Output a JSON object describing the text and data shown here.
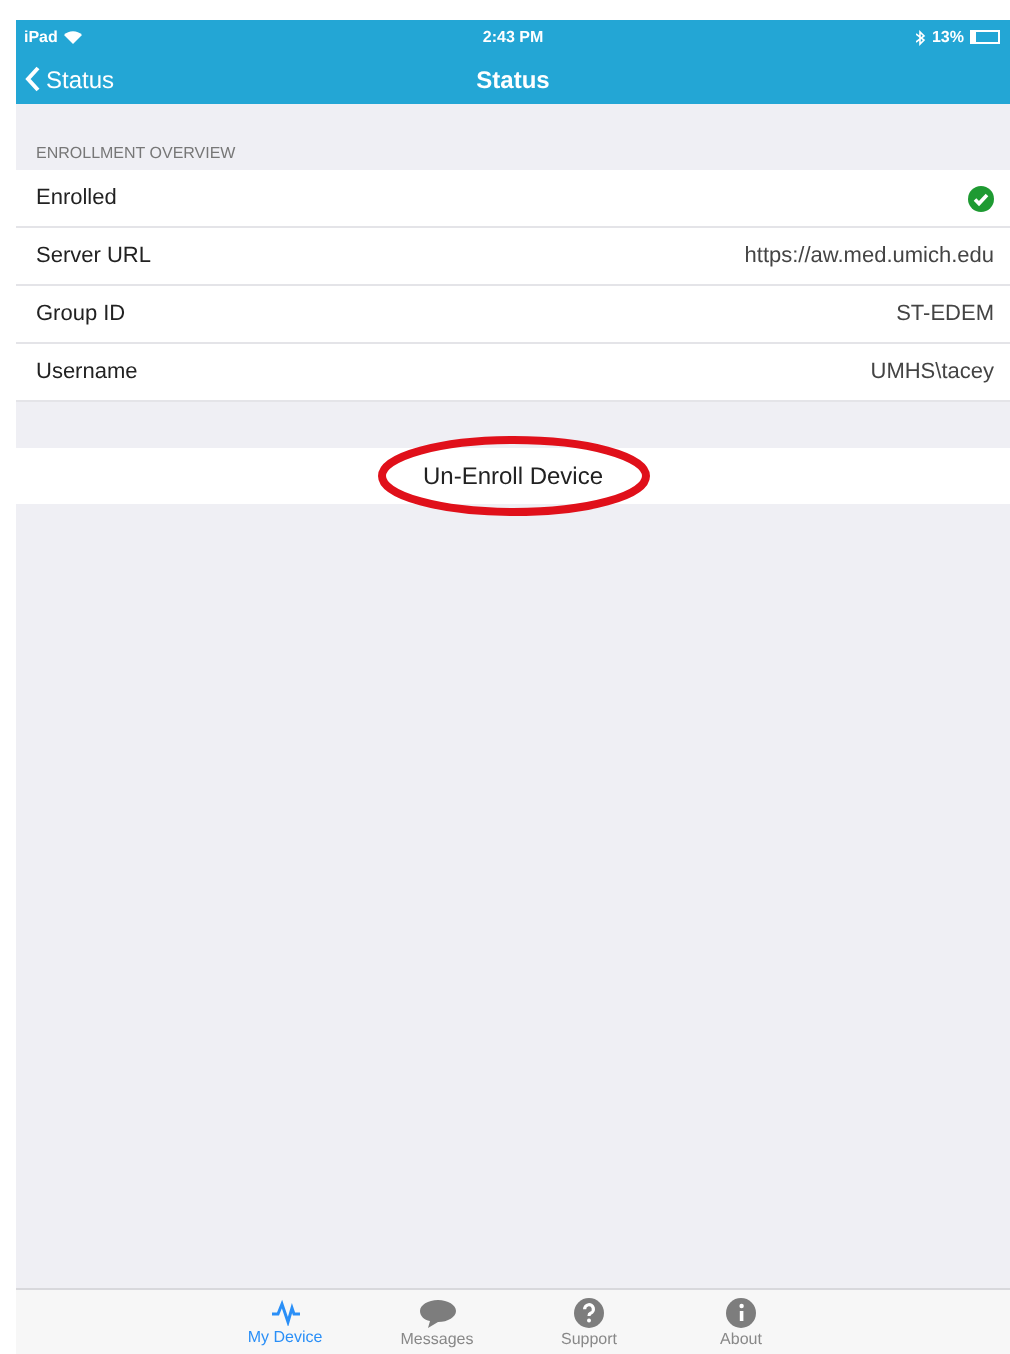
{
  "status_bar": {
    "device": "iPad",
    "time": "2:43 PM",
    "battery": "13%"
  },
  "nav": {
    "back": "Status",
    "title": "Status"
  },
  "section": {
    "header": "ENROLLMENT OVERVIEW",
    "rows": [
      {
        "label": "Enrolled",
        "kind": "check",
        "checked": true
      },
      {
        "label": "Server URL",
        "kind": "value",
        "value": "https://aw.med.umich.edu"
      },
      {
        "label": "Group ID",
        "kind": "value",
        "value": "ST-EDEM"
      },
      {
        "label": "Username",
        "kind": "value",
        "value": "UMHS\\tacey"
      }
    ]
  },
  "action": {
    "label": "Un-Enroll Device",
    "highlighted": true
  },
  "tabs": [
    {
      "label": "My Device",
      "kind": "pulse",
      "selected": true
    },
    {
      "label": "Messages",
      "kind": "bubble",
      "selected": false
    },
    {
      "label": "Support",
      "kind": "question",
      "selected": false
    },
    {
      "label": "About",
      "kind": "info",
      "selected": false
    }
  ]
}
